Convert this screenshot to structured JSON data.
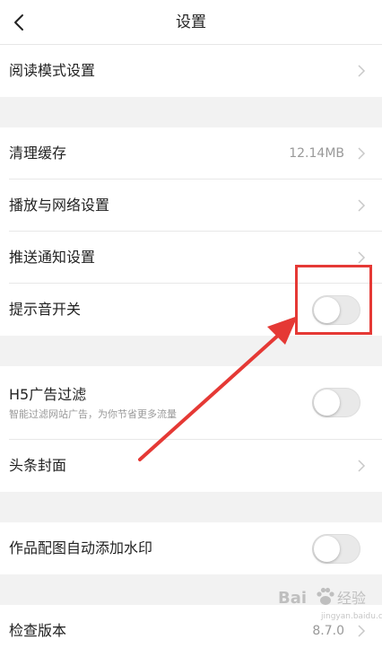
{
  "nav": {
    "title": "设置",
    "back_icon": "chevron-left-icon"
  },
  "rows": {
    "reading_mode": {
      "label": "阅读模式设置"
    },
    "clear_cache": {
      "label": "清理缓存",
      "value": "12.14MB"
    },
    "playback_network": {
      "label": "播放与网络设置"
    },
    "push_notifications": {
      "label": "推送通知设置"
    },
    "sound_toggle": {
      "label": "提示音开关",
      "on": false
    },
    "h5_ad_filter": {
      "label": "H5广告过滤",
      "description": "智能过滤网站广告，为你节省更多流量",
      "on": false
    },
    "headline_cover": {
      "label": "头条封面"
    },
    "auto_watermark": {
      "label": "作品配图自动添加水印",
      "on": false
    },
    "check_version": {
      "label": "检查版本",
      "value": "8.7.0"
    }
  },
  "annotation": {
    "color": "#e53935"
  },
  "watermark": {
    "brand": "Bai",
    "text": "经验",
    "sub": "jingyan.baidu.com"
  },
  "colors": {
    "background": "#f2f2f2",
    "card": "#ffffff",
    "secondary_text": "#999999",
    "toggle_off": "#e9e9e9"
  }
}
